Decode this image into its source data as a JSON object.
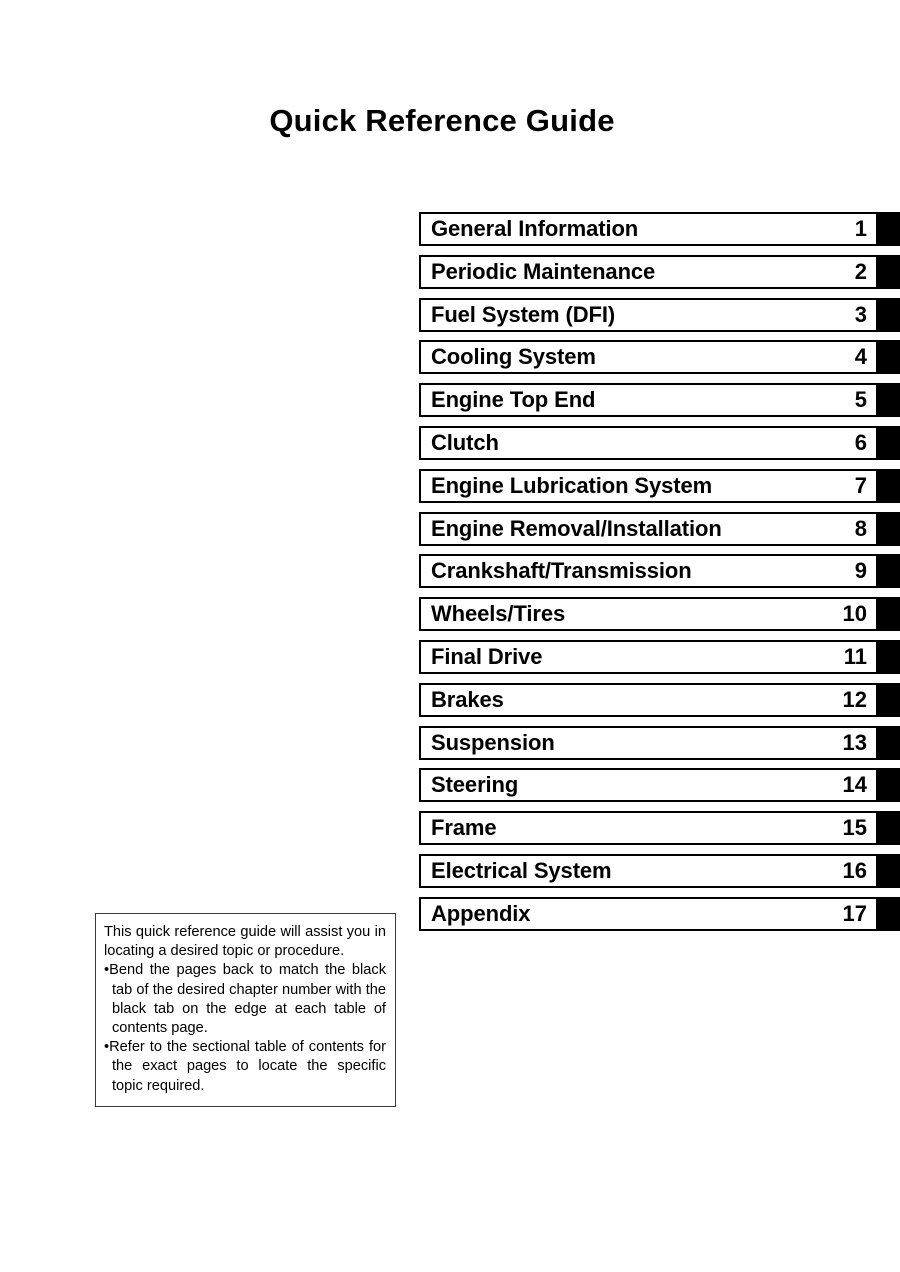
{
  "page": {
    "title": "Quick Reference Guide",
    "background_color": "#ffffff",
    "text_color": "#000000",
    "tab_color": "#000000"
  },
  "chapter_index": {
    "rows": [
      {
        "label": "General Information",
        "number": "1"
      },
      {
        "label": "Periodic Maintenance",
        "number": "2"
      },
      {
        "label": "Fuel System (DFI)",
        "number": "3"
      },
      {
        "label": "Cooling System",
        "number": "4"
      },
      {
        "label": "Engine Top End",
        "number": "5"
      },
      {
        "label": "Clutch",
        "number": "6"
      },
      {
        "label": "Engine Lubrication System",
        "number": "7"
      },
      {
        "label": "Engine Removal/Installation",
        "number": "8"
      },
      {
        "label": "Crankshaft/Transmission",
        "number": "9"
      },
      {
        "label": "Wheels/Tires",
        "number": "10"
      },
      {
        "label": "Final Drive",
        "number": "11"
      },
      {
        "label": "Brakes",
        "number": "12"
      },
      {
        "label": "Suspension",
        "number": "13"
      },
      {
        "label": "Steering",
        "number": "14"
      },
      {
        "label": "Frame",
        "number": "15"
      },
      {
        "label": "Electrical System",
        "number": "16"
      },
      {
        "label": "Appendix",
        "number": "17"
      }
    ]
  },
  "note_box": {
    "intro": "This quick reference guide will assist you in locating a desired topic or procedure.",
    "bullet_marker": "•",
    "bullets": [
      "Bend the pages back to match the black tab of the desired chapter number with the black tab on the edge at each table of contents page.",
      "Refer to the sectional table of contents for the exact pages to locate the specific topic required."
    ]
  }
}
